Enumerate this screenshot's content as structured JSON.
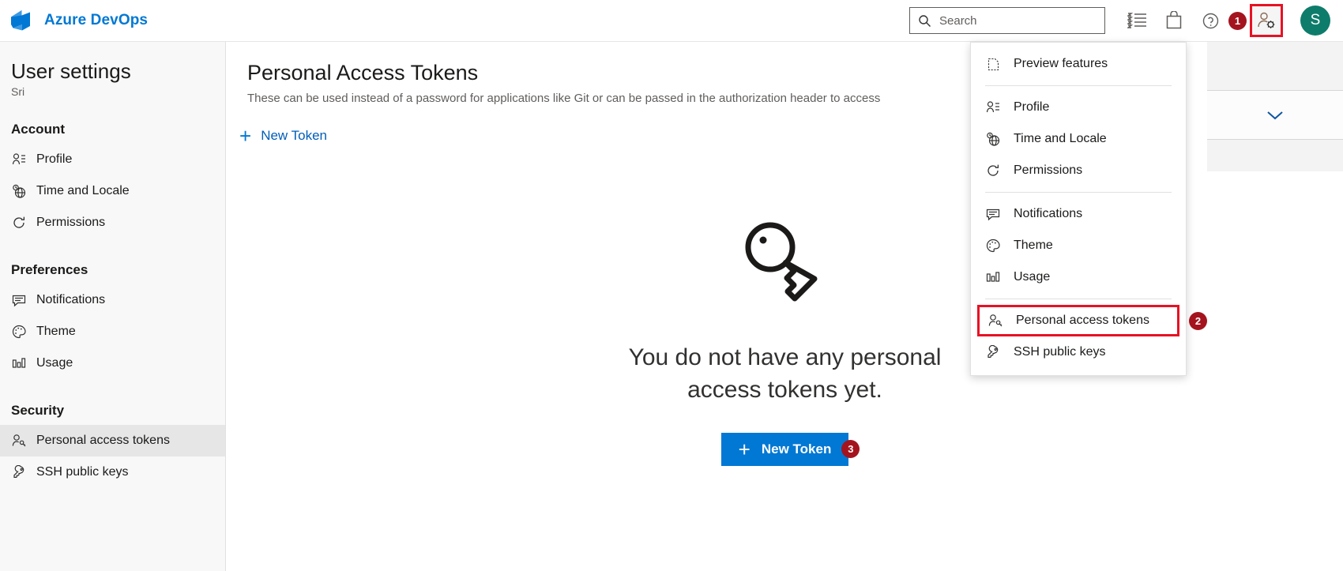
{
  "topbar": {
    "brand": "Azure DevOps",
    "logo_icon": "azure-devops-logo",
    "search": {
      "placeholder": "Search",
      "value": "",
      "icon": "search-icon"
    },
    "icons": [
      {
        "name": "work-items-icon",
        "glyph": "list"
      },
      {
        "name": "marketplace-icon",
        "glyph": "bag"
      },
      {
        "name": "help-icon",
        "glyph": "question"
      }
    ],
    "settings_icon": "user-settings-icon",
    "settings_badge": "1",
    "avatar_initial": "S"
  },
  "sidebar": {
    "title": "User settings",
    "subtitle": "Sri",
    "groups": [
      {
        "label": "Account",
        "items": [
          {
            "label": "Profile",
            "icon": "profile-icon",
            "active": false
          },
          {
            "label": "Time and Locale",
            "icon": "globe-clock-icon",
            "active": false
          },
          {
            "label": "Permissions",
            "icon": "permissions-icon",
            "active": false
          }
        ]
      },
      {
        "label": "Preferences",
        "items": [
          {
            "label": "Notifications",
            "icon": "notifications-icon",
            "active": false
          },
          {
            "label": "Theme",
            "icon": "theme-palette-icon",
            "active": false
          },
          {
            "label": "Usage",
            "icon": "usage-chart-icon",
            "active": false
          }
        ]
      },
      {
        "label": "Security",
        "items": [
          {
            "label": "Personal access tokens",
            "icon": "personal-access-tokens-icon",
            "active": true
          },
          {
            "label": "SSH public keys",
            "icon": "ssh-key-icon",
            "active": false
          }
        ]
      }
    ]
  },
  "main": {
    "title": "Personal Access Tokens",
    "description": "These can be used instead of a password for applications like Git or can be passed in the authorization header to access",
    "new_token_link": "New Token",
    "empty_icon": "key-icon",
    "empty_message": "You do not have any personal access tokens yet.",
    "new_token_button": "New Token",
    "new_token_button_badge": "3"
  },
  "menu": {
    "sections": [
      {
        "items": [
          {
            "label": "Preview features",
            "icon": "preview-features-icon",
            "highlighted": false,
            "badge": ""
          }
        ]
      },
      {
        "items": [
          {
            "label": "Profile",
            "icon": "profile-icon",
            "highlighted": false,
            "badge": ""
          },
          {
            "label": "Time and Locale",
            "icon": "globe-clock-icon",
            "highlighted": false,
            "badge": ""
          },
          {
            "label": "Permissions",
            "icon": "permissions-icon",
            "highlighted": false,
            "badge": ""
          }
        ]
      },
      {
        "items": [
          {
            "label": "Notifications",
            "icon": "notifications-icon",
            "highlighted": false,
            "badge": ""
          },
          {
            "label": "Theme",
            "icon": "theme-palette-icon",
            "highlighted": false,
            "badge": ""
          },
          {
            "label": "Usage",
            "icon": "usage-chart-icon",
            "highlighted": false,
            "badge": ""
          }
        ]
      },
      {
        "items": [
          {
            "label": "Personal access tokens",
            "icon": "personal-access-tokens-icon",
            "highlighted": true,
            "badge": "2"
          },
          {
            "label": "SSH public keys",
            "icon": "ssh-key-icon",
            "highlighted": false,
            "badge": ""
          }
        ]
      }
    ]
  },
  "right_edge": {
    "chevron_icon": "chevron-down-icon"
  },
  "colors": {
    "accent": "#0078d4",
    "brand": "#0078d4",
    "highlight_box": "#e81123",
    "badge": "#a4141e",
    "avatar": "#0e7c6b",
    "sidebar_bg": "#f8f8f8",
    "selected_bg": "#e6e6e6"
  }
}
